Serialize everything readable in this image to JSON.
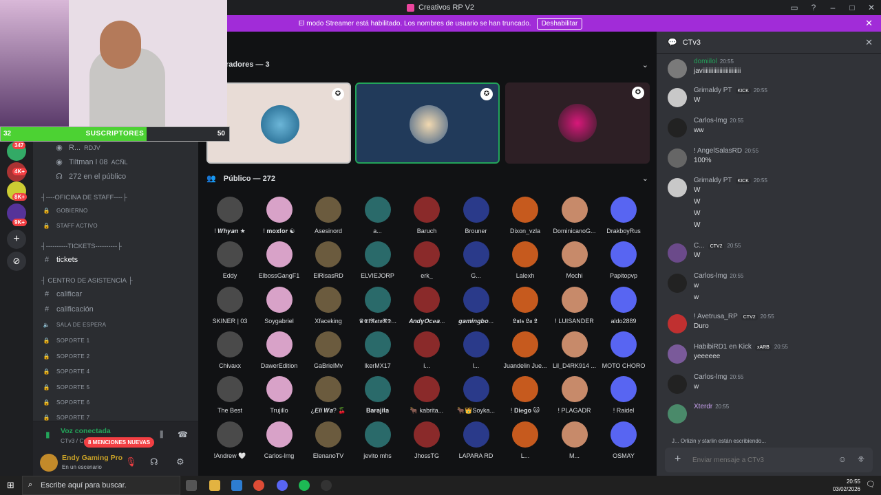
{
  "titlebar": {
    "title": "Creativos RP V2"
  },
  "streamer_banner": {
    "text": "El modo Streamer está habilitado. Los nombres de usuario se han truncado.",
    "button": "Deshabilitar"
  },
  "server_badges": [
    "347",
    "4K+",
    "8K+",
    "9K+"
  ],
  "channels": {
    "stage_users": [
      {
        "name": "R...",
        "tag": "RDJV"
      },
      {
        "name": "Tiltman l 08",
        "tag": "ACÑL"
      }
    ],
    "audience": "272 en el público",
    "cat1": "┤----OFICINA DE STAFF----├",
    "staff": [
      "GOBIERNO",
      "STAFF ACTIVO"
    ],
    "cat2": "┤----------TICKETS----------├",
    "tickets": "tickets",
    "cat3": "┤ CENTRO DE ASISTENCIA ├",
    "asistencia": [
      "calificar",
      "calificación"
    ],
    "sala": "SALA DE ESPERA",
    "soportes": [
      "SOPORTE 1",
      "SOPORTE 2",
      "SOPORTE 4",
      "SOPORTE 5",
      "SOPORTE 6",
      "SOPORTE 7"
    ],
    "mentions": "8 MENCIONES NUEVAS",
    "voice_status": "Voz conectada",
    "voice_channel": "CTv3 / Creativos RP V2",
    "username": "Endy Gaming Pro",
    "user_status": "En un escenario"
  },
  "stage": {
    "speakers_header": "radores — 3",
    "public_header": "Público — 272",
    "audience": [
      "! 𝑾𝒉𝒚𝒂𝒏 ★",
      "! 𝐦𝐨𝐱𝐟𝐨𝐫 ☯",
      "Asesinord",
      "a...",
      "Baruch",
      "Brouner",
      "Dixon_vzla",
      "DominicanoG...",
      "DrakboyRus",
      "Eddy",
      "ElbossGangF1",
      "ElRisasRD",
      "ELVIEJORP",
      "erk_",
      "G...",
      "Lalexh",
      "Mochi",
      "Papitopvp",
      "SKINER | 03",
      "Soygabriel",
      "Xfaceking",
      "♛𝕰𝖑𝕽𝖆𝖙𝖔𝕽𝕯...",
      "𝑨𝒏𝒅𝒚𝑶𝒄𝒆𝒂...",
      "𝒈𝒂𝒎𝒊𝒏𝒈𝒃𝒐...",
      "𝕷𝖚𝖎𝖘 𝕷𝖆 𝕷",
      "! LUISANDER",
      "aldo2889",
      "Chivaxx",
      "DawerEdition",
      "GaBrielMv",
      "IkerMX17",
      "i...",
      "l...",
      "Juandelin Jue...",
      "Lil_D4RK914 ...",
      "MOTO CHORO",
      "The Best",
      "Trujillo",
      "¿𝑬𝒍𝒊 𝑾𝒂? 🍒",
      "𝐁𝐚𝐫𝐚𝐣𝐢𝐭𝐚",
      "🐂 kabrita...",
      "🐂👑Soyka...",
      "! 𝐃𝐢𝐞𝐠𝐨 🐱",
      "! PLAGADR",
      "! Raidel",
      "!Andrew 🤍",
      "Carlos-lmg",
      "ElenanoTV",
      "jevito mhs",
      "JhossTG",
      "LAPARA RD",
      "L...",
      "M...",
      "OSMAY"
    ]
  },
  "chat": {
    "title": "CTv3",
    "messages": [
      {
        "name": "domiilol",
        "time": "20:55",
        "lines": [
          "javiiiiiiiiiiiiiiiiiiiiiiiii"
        ]
      },
      {
        "name": "Grimaldy PT",
        "tag": "KICK",
        "time": "20:55",
        "lines": [
          "W"
        ]
      },
      {
        "name": "Carlos-lmg",
        "time": "20:55",
        "lines": [
          "ww"
        ]
      },
      {
        "name": "! AngelSalasRD",
        "time": "20:55",
        "lines": [
          "100%"
        ]
      },
      {
        "name": "Grimaldy PT",
        "tag": "KICK",
        "time": "20:55",
        "lines": [
          "W",
          "W",
          "W",
          "W"
        ]
      },
      {
        "name": "C...",
        "tag": "CTV2",
        "time": "20:55",
        "lines": [
          "W"
        ]
      },
      {
        "name": "Carlos-lmg",
        "time": "20:55",
        "lines": [
          "w",
          "w"
        ]
      },
      {
        "name": "! Avetrusa_RP",
        "tag": "CTV2",
        "time": "20:55",
        "lines": [
          "Duro"
        ]
      },
      {
        "name": "HabibiRD1 en Kick",
        "tag": "xARB",
        "time": "20:55",
        "lines": [
          "yeeeeee"
        ]
      },
      {
        "name": "Carlos-lmg",
        "time": "20:55",
        "lines": [
          "w"
        ]
      },
      {
        "name": "Xterdr",
        "time": "20:55",
        "lines": [
          ""
        ]
      }
    ],
    "typing": "J... Orlizin y starlin están escribiendo...",
    "input_placeholder": "Enviar mensaje a CTv3"
  },
  "overlay": {
    "sub_left": "32",
    "sub_label": "SUSCRIPTORES",
    "sub_right": "50",
    "sub_progress": 0.64
  },
  "taskbar": {
    "search": "Escribe aquí para buscar.",
    "time": "20:55",
    "date": "03/02/2026"
  }
}
